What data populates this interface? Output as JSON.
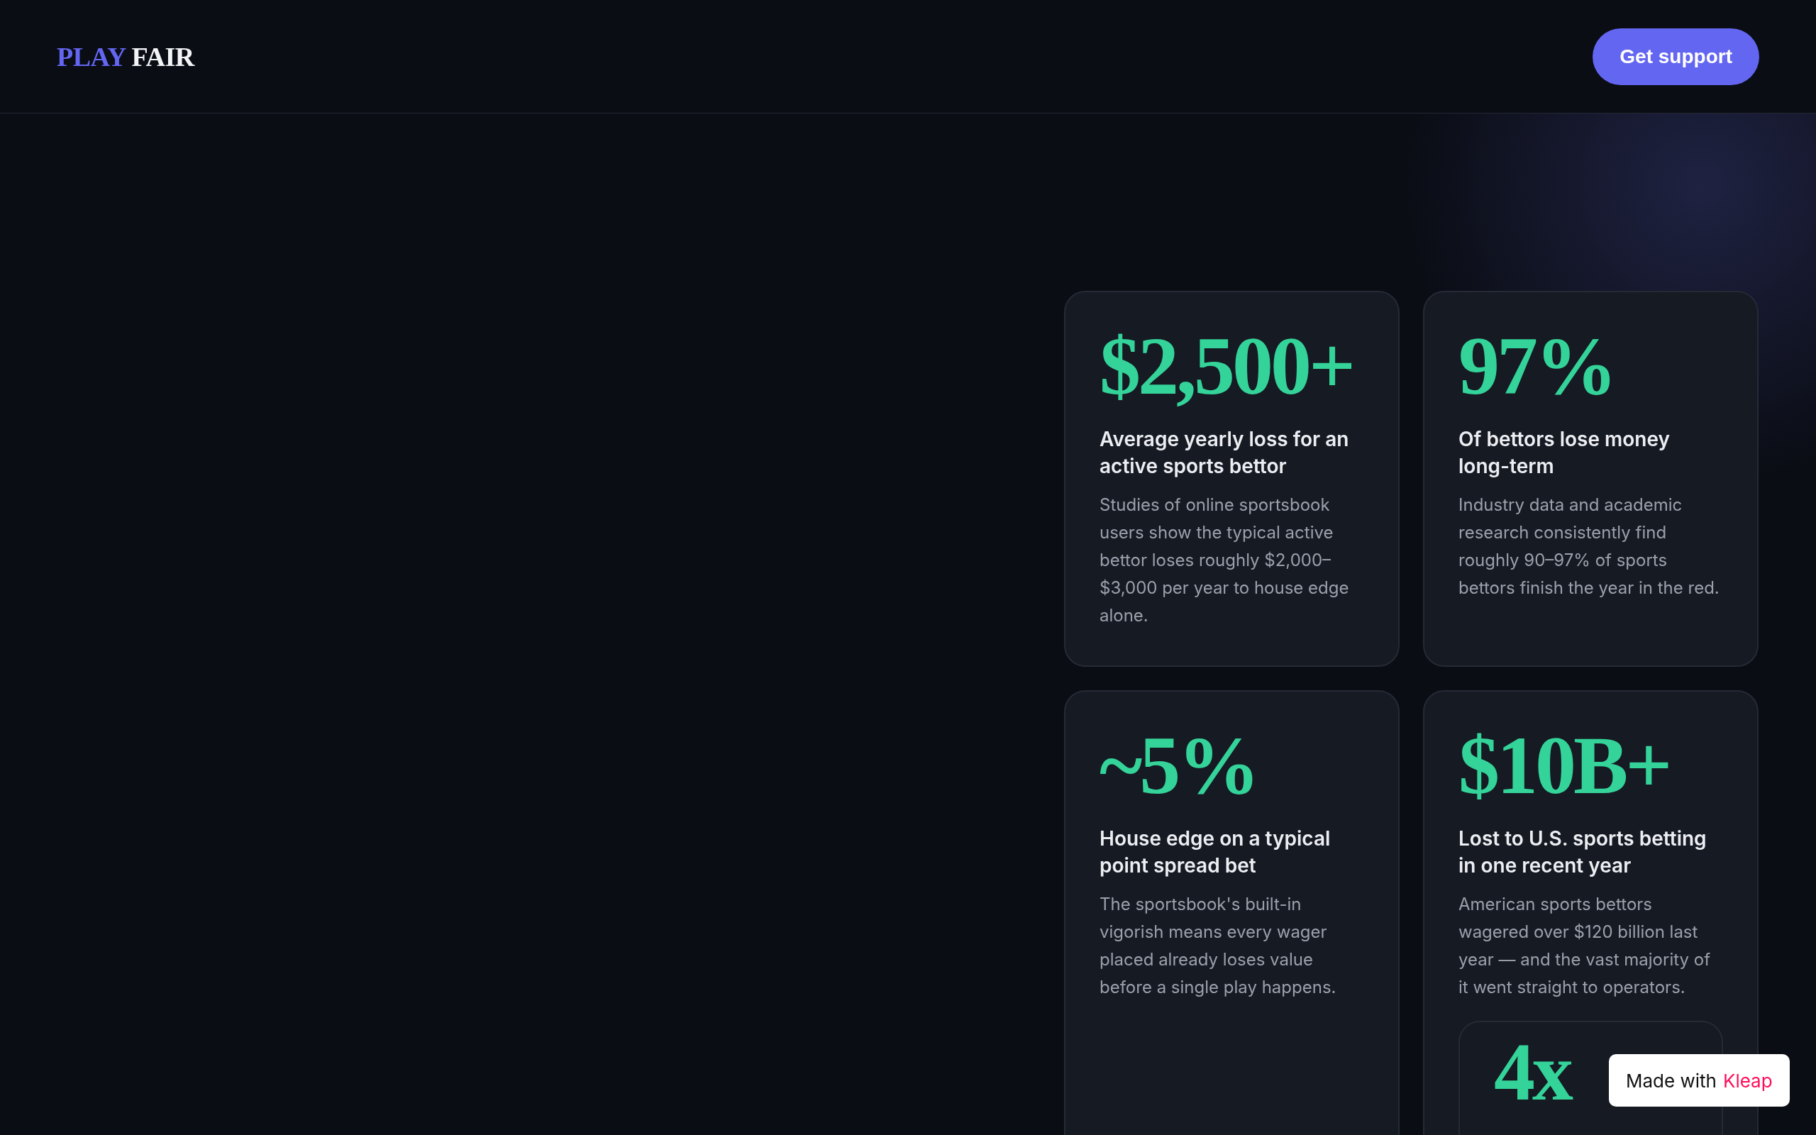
{
  "header": {
    "logo": {
      "first": "PLAY",
      "second": "FAIR"
    },
    "button": "Get support"
  },
  "stats": [
    {
      "value": "$2,500+",
      "title": "Average yearly loss for an active sports bettor",
      "body": "Studies of online sportsbook users show the typical active bettor loses roughly $2,000–$3,000 per year to house edge alone."
    },
    {
      "value": "97%",
      "title": "Of bettors lose money long-term",
      "body": "Industry data and academic research consistently find roughly 90–97% of sports bettors finish the year in the red."
    },
    {
      "value": "~5%",
      "title": "House edge on a typical point spread bet",
      "body": "The sportsbook's built-in vigorish means every wager placed already loses value before a single play happens."
    },
    {
      "value": "$10B+",
      "title": "Lost to U.S. sports betting in one recent year",
      "body": "American sports bettors wagered over $120 billion last year — and the vast majority of it went straight to operators.",
      "inner": {
        "value": "4x"
      }
    }
  ],
  "badge": {
    "text": "Made with",
    "brand": "Kleap"
  }
}
